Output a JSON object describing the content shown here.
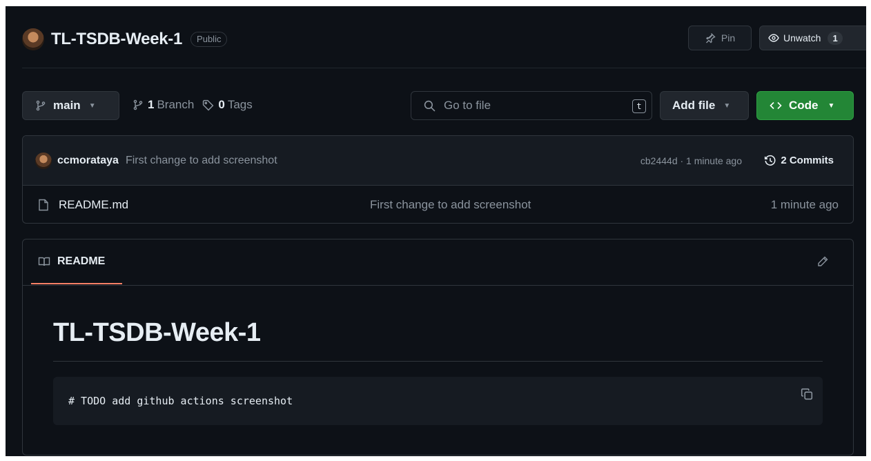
{
  "repo": {
    "name": "TL-TSDB-Week-1",
    "visibility": "Public",
    "pin_label": "Pin",
    "watch_label": "Unwatch",
    "watch_count": "1"
  },
  "toolbar": {
    "branch": "main",
    "branch_count": "1",
    "branch_label": "Branch",
    "tag_count": "0",
    "tag_label": "Tags",
    "search_placeholder": "Go to file",
    "search_shortcut": "t",
    "add_file_label": "Add file",
    "code_label": "Code"
  },
  "latest_commit": {
    "user": "ccmorataya",
    "message": "First change to add screenshot",
    "meta": "cb2444d · 1 minute ago",
    "commits_label": "2 Commits"
  },
  "files": [
    {
      "name": "README.md",
      "message": "First change to add screenshot",
      "time": "1 minute ago"
    }
  ],
  "readme": {
    "tab_label": "README",
    "title": "TL-TSDB-Week-1",
    "code": "# TODO add github actions screenshot"
  },
  "colors": {
    "background": "#0d1117",
    "accent_green": "#238636",
    "tab_underline": "#f78166",
    "muted_text": "#8b949e",
    "border": "#30363d"
  },
  "icons": [
    "pin-icon",
    "eye-icon",
    "git-branch-icon",
    "tag-icon",
    "search-icon",
    "code-icon",
    "history-icon",
    "file-icon",
    "book-icon",
    "pencil-icon",
    "copy-icon"
  ]
}
